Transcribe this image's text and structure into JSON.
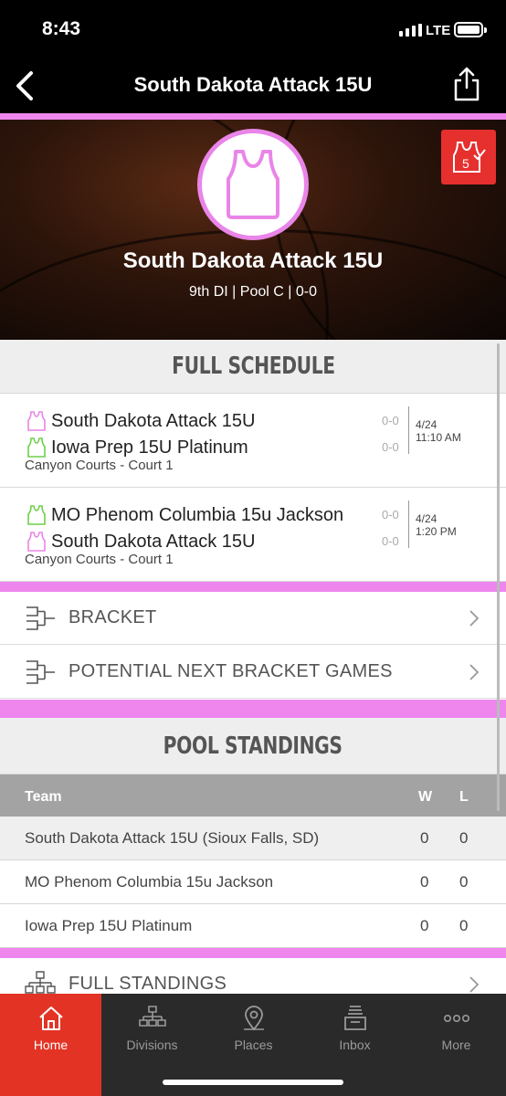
{
  "status": {
    "time": "8:43",
    "network": "LTE"
  },
  "nav": {
    "title": "South Dakota Attack 15U",
    "back_icon": "chevron-left-icon",
    "share_icon": "share-icon"
  },
  "hero": {
    "team_name": "South Dakota Attack 15U",
    "subtitle": "9th DI | Pool C | 0-0",
    "avatar_icon": "jersey-icon",
    "badge_icon": "jersey-check-icon",
    "badge_number": "5"
  },
  "schedule": {
    "header": "FULL SCHEDULE",
    "games": [
      {
        "team1": "South Dakota Attack 15U",
        "team1_color": "#e985e8",
        "team1_score": "0-0",
        "team2": "Iowa Prep 15U Platinum",
        "team2_color": "#6fcf4a",
        "team2_score": "0-0",
        "date": "4/24",
        "time": "11:10 AM",
        "venue": "Canyon Courts - Court 1"
      },
      {
        "team1": "MO Phenom Columbia  15u Jackson",
        "team1_color": "#6fcf4a",
        "team1_score": "0-0",
        "team2": "South Dakota Attack 15U",
        "team2_color": "#e985e8",
        "team2_score": "0-0",
        "date": "4/24",
        "time": "1:20 PM",
        "venue": "Canyon Courts - Court 1"
      }
    ]
  },
  "links": {
    "bracket": "BRACKET",
    "potential": "POTENTIAL NEXT BRACKET GAMES",
    "full_standings": "FULL STANDINGS"
  },
  "standings": {
    "header": "POOL STANDINGS",
    "columns": {
      "team": "Team",
      "w": "W",
      "l": "L"
    },
    "rows": [
      {
        "team": "South Dakota Attack 15U (Sioux Falls, SD)",
        "w": "0",
        "l": "0",
        "highlight": true
      },
      {
        "team": "MO Phenom Columbia  15u Jackson",
        "w": "0",
        "l": "0",
        "highlight": false
      },
      {
        "team": "Iowa Prep 15U Platinum",
        "w": "0",
        "l": "0",
        "highlight": false
      }
    ]
  },
  "tabs": [
    {
      "label": "Home",
      "icon": "home-icon",
      "active": true
    },
    {
      "label": "Divisions",
      "icon": "divisions-icon",
      "active": false
    },
    {
      "label": "Places",
      "icon": "map-pin-icon",
      "active": false
    },
    {
      "label": "Inbox",
      "icon": "inbox-icon",
      "active": false
    },
    {
      "label": "More",
      "icon": "more-icon",
      "active": false
    }
  ],
  "colors": {
    "accent_pink": "#ee86ee",
    "active_tab": "#e33325",
    "badge_red": "#e5302e"
  }
}
